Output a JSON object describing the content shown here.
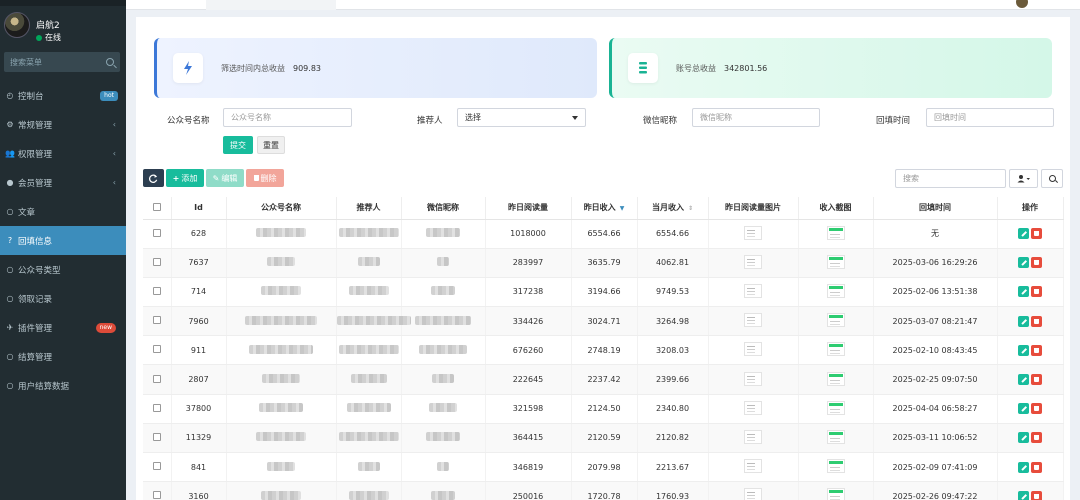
{
  "sidebar": {
    "user": {
      "name": "启航2",
      "status": "在线"
    },
    "search_placeholder": "搜索菜单",
    "items": [
      {
        "label": "控制台",
        "icon": "dashboard-icon",
        "badge": "hot"
      },
      {
        "label": "常规管理",
        "icon": "cogs-icon",
        "chevron": "‹"
      },
      {
        "label": "权限管理",
        "icon": "group-icon",
        "chevron": "‹"
      },
      {
        "label": "会员管理",
        "icon": "user-icon",
        "chevron": "‹"
      },
      {
        "label": "文章",
        "icon": "circle-icon"
      },
      {
        "label": "回填信息",
        "icon": "question-icon",
        "active": true
      },
      {
        "label": "公众号类型",
        "icon": "circle-icon"
      },
      {
        "label": "领取记录",
        "icon": "circle-icon"
      },
      {
        "label": "插件管理",
        "icon": "rocket-icon",
        "badge": "new"
      },
      {
        "label": "结算管理",
        "icon": "circle-icon"
      },
      {
        "label": "用户结算数据",
        "icon": "circle-icon"
      }
    ]
  },
  "stats": {
    "range_income": {
      "label": "筛选时间内总收益",
      "value": "909.83",
      "icon": "bolt-icon",
      "accent": "#3c78d8"
    },
    "total_income": {
      "label": "账号总收益",
      "value": "342801.56",
      "icon": "coins-icon",
      "accent": "#1ab394"
    }
  },
  "filters": {
    "account_name": {
      "label": "公众号名称",
      "placeholder": "公众号名称"
    },
    "referrer": {
      "label": "推荐人",
      "value": "选择"
    },
    "wechat_nick": {
      "label": "微信昵称",
      "placeholder": "微信昵称"
    },
    "fill_time": {
      "label": "回填时间",
      "placeholder": "回填时间"
    },
    "submit_label": "提交",
    "reset_label": "重置"
  },
  "toolbar": {
    "add_label": "添加",
    "edit_label": "编辑",
    "delete_label": "删除",
    "search_placeholder": "搜索"
  },
  "table": {
    "headers": {
      "id": "Id",
      "account_name": "公众号名称",
      "referrer": "推荐人",
      "wechat_nick": "微信昵称",
      "yesterday_reads": "昨日阅读量",
      "yesterday_income": "昨日收入",
      "month_income": "当月收入",
      "reads_screenshot": "昨日阅读量图片",
      "income_screenshot": "收入截图",
      "fill_time": "回填时间",
      "actions": "操作"
    },
    "rows": [
      {
        "id": "628",
        "reads": "1018000",
        "yincome": "6554.66",
        "mincome": "6554.66",
        "time": "无"
      },
      {
        "id": "7637",
        "reads": "283997",
        "yincome": "3635.79",
        "mincome": "4062.81",
        "time": "2025-03-06 16:29:26"
      },
      {
        "id": "714",
        "reads": "317238",
        "yincome": "3194.66",
        "mincome": "9749.53",
        "time": "2025-02-06 13:51:38"
      },
      {
        "id": "7960",
        "reads": "334426",
        "yincome": "3024.71",
        "mincome": "3264.98",
        "time": "2025-03-07 08:21:47"
      },
      {
        "id": "911",
        "reads": "676260",
        "yincome": "2748.19",
        "mincome": "3208.03",
        "time": "2025-02-10 08:43:45"
      },
      {
        "id": "2807",
        "reads": "222645",
        "yincome": "2237.42",
        "mincome": "2399.66",
        "time": "2025-02-25 09:07:50"
      },
      {
        "id": "37800",
        "reads": "321598",
        "yincome": "2124.50",
        "mincome": "2340.80",
        "time": "2025-04-04 06:58:27"
      },
      {
        "id": "11329",
        "reads": "364415",
        "yincome": "2120.59",
        "mincome": "2120.82",
        "time": "2025-03-11 10:06:52"
      },
      {
        "id": "841",
        "reads": "346819",
        "yincome": "2079.98",
        "mincome": "2213.67",
        "time": "2025-02-09 07:41:09"
      },
      {
        "id": "3160",
        "reads": "250016",
        "yincome": "1720.78",
        "mincome": "1760.93",
        "time": "2025-02-26 09:47:22"
      }
    ]
  }
}
